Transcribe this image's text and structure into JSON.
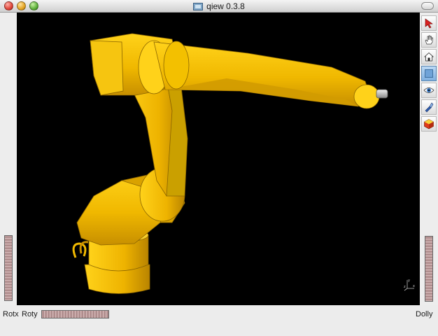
{
  "window": {
    "title": "qiew 0.3.8"
  },
  "toolbar": {
    "tools": [
      {
        "name": "select-arrow-icon"
      },
      {
        "name": "hand-pan-icon"
      },
      {
        "name": "home-view-icon"
      },
      {
        "name": "fit-view-icon"
      },
      {
        "name": "eye-view-icon"
      },
      {
        "name": "flashlight-icon"
      },
      {
        "name": "shading-cube-icon"
      }
    ]
  },
  "bottom": {
    "rotx_label": "Rotx",
    "roty_label": "Roty",
    "dolly_label": "Dolly"
  },
  "viewport": {
    "background": "#000000",
    "model_color": "#f5c400"
  },
  "axes": {
    "x_label": "x",
    "y_label": "y",
    "z_label": "z"
  }
}
